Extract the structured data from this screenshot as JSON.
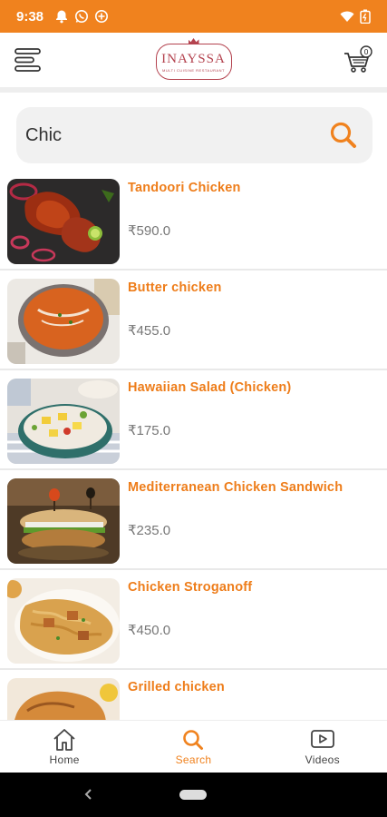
{
  "status_bar": {
    "time": "9:38",
    "background": "#f0821e",
    "left_icons": [
      "bell-icon",
      "whatsapp-icon",
      "data-saver-icon"
    ],
    "right_icons": [
      "wifi-icon",
      "battery-icon"
    ]
  },
  "header": {
    "logo_text": "INAYSSA",
    "logo_subtext": "MULTI CUISINE RESTAURANT",
    "cart_count": "0"
  },
  "search": {
    "value": "Chic",
    "placeholder": "Search",
    "icon_color": "#f0821e"
  },
  "results": [
    {
      "name": "Tandoori Chicken",
      "price": "₹590.0"
    },
    {
      "name": "Butter chicken",
      "price": "₹455.0"
    },
    {
      "name": "Hawaiian Salad (Chicken)",
      "price": "₹175.0"
    },
    {
      "name": "Mediterranean Chicken Sandwich",
      "price": "₹235.0"
    },
    {
      "name": "Chicken Stroganoff",
      "price": "₹450.0"
    },
    {
      "name": "Grilled chicken",
      "price": ""
    }
  ],
  "bottom_nav": {
    "items": [
      {
        "label": "Home",
        "icon": "home-icon",
        "active": false
      },
      {
        "label": "Search",
        "icon": "search-icon",
        "active": true
      },
      {
        "label": "Videos",
        "icon": "video-icon",
        "active": false
      }
    ],
    "active_color": "#f0821e"
  },
  "colors": {
    "accent": "#f0821e",
    "brand": "#b4434f",
    "item_title": "#ee7d1a",
    "price": "#777777"
  }
}
